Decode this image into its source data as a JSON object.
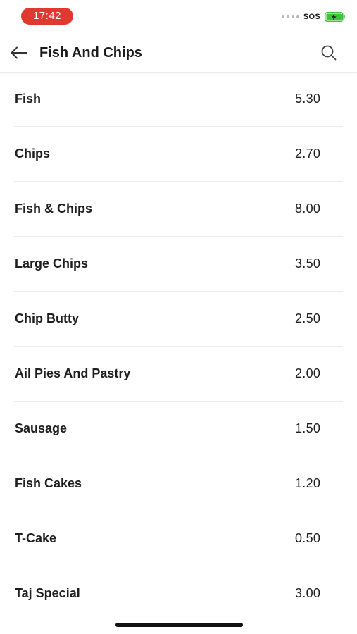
{
  "status_bar": {
    "time": "17:42",
    "carrier": "SOS",
    "battery_color": "#3ec33e"
  },
  "header": {
    "title": "Fish And Chips",
    "back_icon": "arrow-left-icon",
    "search_icon": "search-icon"
  },
  "menu": {
    "items": [
      {
        "name": "Fish",
        "price": "5.30"
      },
      {
        "name": "Chips",
        "price": "2.70"
      },
      {
        "name": "Fish & Chips",
        "price": "8.00"
      },
      {
        "name": "Large Chips",
        "price": "3.50"
      },
      {
        "name": "Chip Butty",
        "price": "2.50"
      },
      {
        "name": "Ail Pies And Pastry",
        "price": "2.00"
      },
      {
        "name": "Sausage",
        "price": "1.50"
      },
      {
        "name": "Fish Cakes",
        "price": "1.20"
      },
      {
        "name": "T-Cake",
        "price": "0.50"
      },
      {
        "name": "Taj Special",
        "price": "3.00"
      }
    ]
  },
  "colors": {
    "time_pill": "#e0392f",
    "text": "#1e1e1e",
    "divider": "#ebebeb"
  }
}
